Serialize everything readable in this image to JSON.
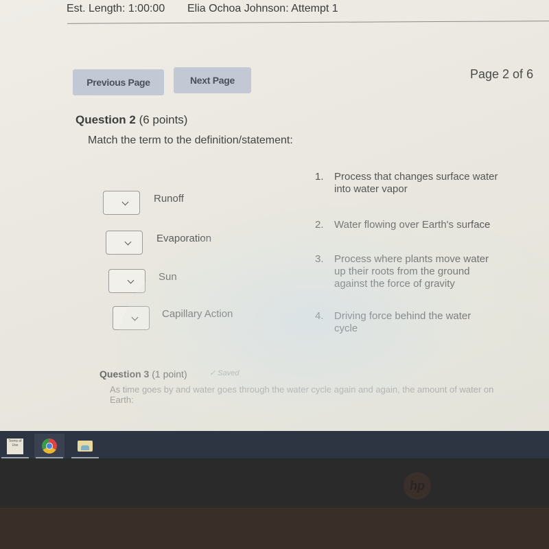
{
  "header": {
    "est_length": "Est. Length: 1:00:00",
    "attempt": "Elia Ochoa Johnson: Attempt 1"
  },
  "nav": {
    "previous_label": "Previous Page",
    "next_label": "Next Page",
    "page_indicator": "Page 2 of 6"
  },
  "question2": {
    "title": "Question 2",
    "points": "(6 points)",
    "prompt": "Match the term to the definition/statement:",
    "terms": [
      {
        "label": "Runoff",
        "selected": ""
      },
      {
        "label": "Evaporation",
        "selected": ""
      },
      {
        "label": "Sun",
        "selected": ""
      },
      {
        "label": "Capillary Action",
        "selected": ""
      }
    ],
    "definitions": [
      {
        "num": "1.",
        "text": "Process that changes surface water\ninto water vapor"
      },
      {
        "num": "2.",
        "text": "Water flowing over Earth's surface"
      },
      {
        "num": "3.",
        "text": "Process where plants move water\nup their roots from the ground\nagainst the force of gravity"
      },
      {
        "num": "4.",
        "text": "Driving force behind the water\ncycle"
      }
    ]
  },
  "question3": {
    "title": "Question 3",
    "points": "(1 point)",
    "status": "Saved",
    "text": "As time goes by and water goes through the water cycle again and again, the amount of water on Earth:"
  },
  "taskbar": {
    "terms_label": "Terms of Use",
    "items": [
      "terms-of-use",
      "chrome",
      "file-explorer"
    ]
  },
  "device": {
    "brand": "hp"
  }
}
